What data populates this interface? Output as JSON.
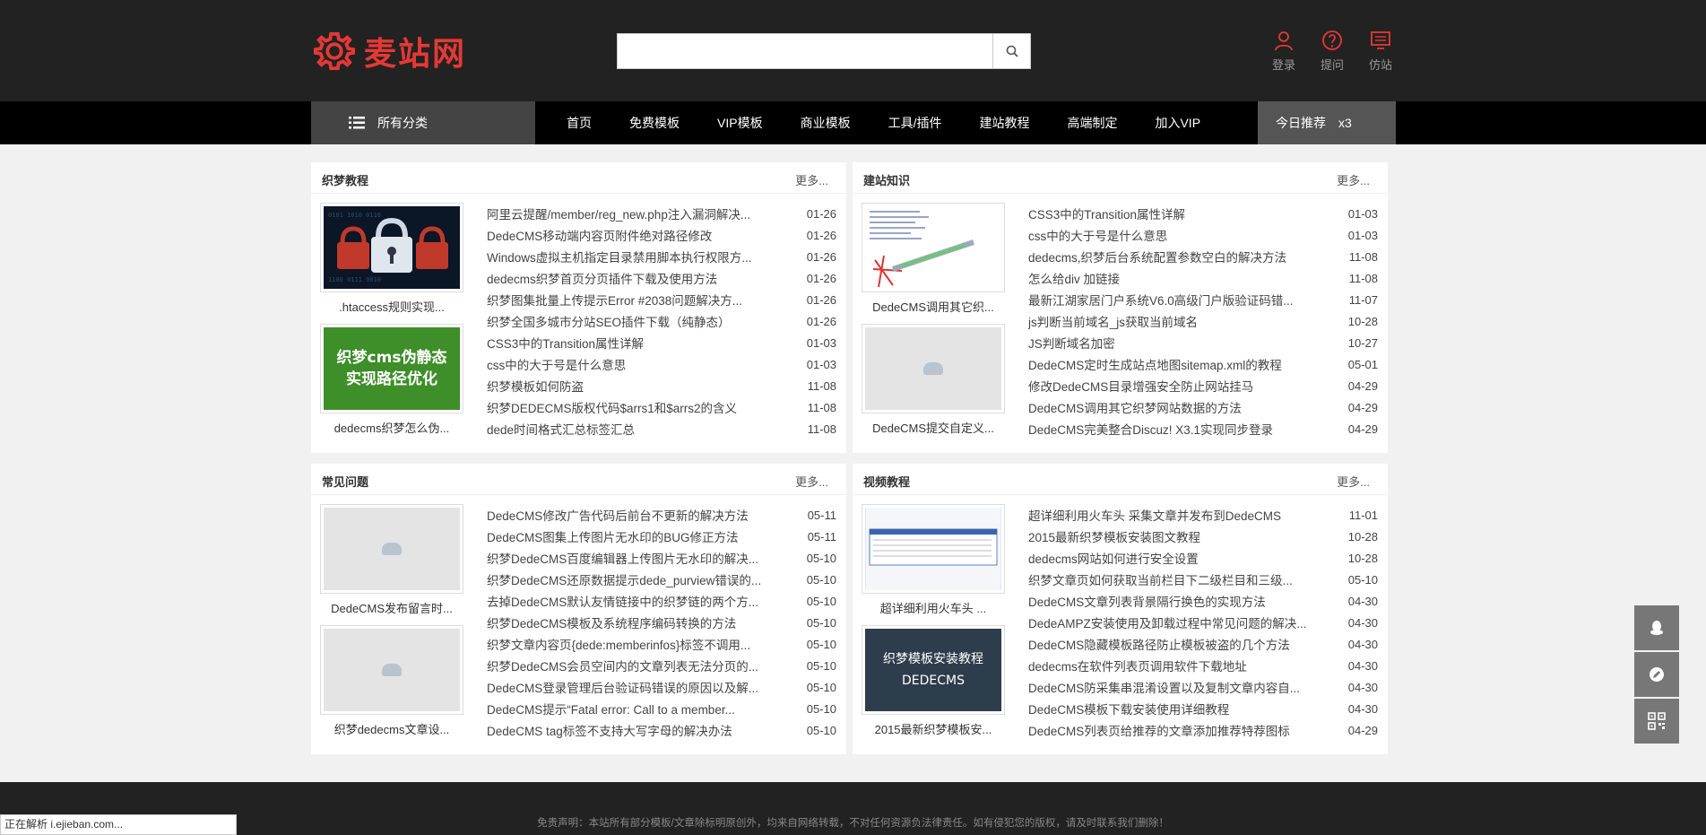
{
  "logo": {
    "text": "麦站网"
  },
  "search": {
    "placeholder": ""
  },
  "user_links": [
    {
      "label": "登录",
      "icon": "user-icon"
    },
    {
      "label": "提问",
      "icon": "question-icon"
    },
    {
      "label": "仿站",
      "icon": "monitor-icon"
    }
  ],
  "nav": {
    "category_label": "所有分类",
    "items": [
      "首页",
      "免费模板",
      "VIP模板",
      "商业模板",
      "工具/插件",
      "建站教程",
      "高端制定",
      "加入VIP"
    ],
    "recommend_label": "今日推荐",
    "recommend_count": "x3"
  },
  "panels": [
    {
      "title": "织梦教程",
      "more": "更多...",
      "thumbs": [
        {
          "caption": ".htaccess规则实现...",
          "kind": "lock-image"
        },
        {
          "caption": "dedecms织梦怎么伪...",
          "kind": "green-banner",
          "banner_line1": "织梦cms伪静态",
          "banner_line2": "实现路径优化"
        }
      ],
      "rows": [
        {
          "title": "阿里云提醒/member/reg_new.php注入漏洞解决...",
          "date": "01-26"
        },
        {
          "title": "DedeCMS移动端内容页附件绝对路径修改",
          "date": "01-26"
        },
        {
          "title": "Windows虚拟主机指定目录禁用脚本执行权限方...",
          "date": "01-26"
        },
        {
          "title": "dedecms织梦首页分页插件下载及使用方法",
          "date": "01-26"
        },
        {
          "title": "织梦图集批量上传提示Error #2038问题解决方...",
          "date": "01-26"
        },
        {
          "title": "织梦全国多城市分站SEO插件下载（纯静态）",
          "date": "01-26"
        },
        {
          "title": "CSS3中的Transition属性详解",
          "date": "01-03"
        },
        {
          "title": "css中的大于号是什么意思",
          "date": "01-03"
        },
        {
          "title": "织梦模板如何防盗",
          "date": "11-08"
        },
        {
          "title": "织梦DEDECMS版权代码$arrs1和$arrs2的含义",
          "date": "11-08"
        },
        {
          "title": "dede时间格式汇总标签汇总",
          "date": "11-08"
        }
      ]
    },
    {
      "title": "建站知识",
      "more": "更多...",
      "thumbs": [
        {
          "caption": "DedeCMS调用其它织...",
          "kind": "code-image"
        },
        {
          "caption": "DedeCMS提交自定义...",
          "kind": "placeholder"
        }
      ],
      "rows": [
        {
          "title": "CSS3中的Transition属性详解",
          "date": "01-03"
        },
        {
          "title": "css中的大于号是什么意思",
          "date": "01-03"
        },
        {
          "title": "dedecms,织梦后台系统配置参数空白的解决方法",
          "date": "11-08"
        },
        {
          "title": "怎么给div 加链接",
          "date": "11-08"
        },
        {
          "title": "最新江湖家居门户系统V6.0高级门户版验证码错...",
          "date": "11-07"
        },
        {
          "title": "js判断当前域名_js获取当前域名",
          "date": "10-28"
        },
        {
          "title": "JS判断域名加密",
          "date": "10-27"
        },
        {
          "title": "DedeCMS定时生成站点地图sitemap.xml的教程",
          "date": "05-01"
        },
        {
          "title": "修改DedeCMS目录增强安全防止网站挂马",
          "date": "04-29"
        },
        {
          "title": "DedeCMS调用其它织梦网站数据的方法",
          "date": "04-29"
        },
        {
          "title": "DedeCMS完美整合Discuz! X3.1实现同步登录",
          "date": "04-29"
        }
      ]
    },
    {
      "title": "常见问题",
      "more": "更多...",
      "thumbs": [
        {
          "caption": "DedeCMS发布留言时...",
          "kind": "placeholder"
        },
        {
          "caption": "织梦dedecms文章设...",
          "kind": "placeholder"
        }
      ],
      "rows": [
        {
          "title": "DedeCMS修改广告代码后前台不更新的解决方法",
          "date": "05-11"
        },
        {
          "title": "DedeCMS图集上传图片无水印的BUG修正方法",
          "date": "05-11"
        },
        {
          "title": "织梦DedeCMS百度编辑器上传图片无水印的解决...",
          "date": "05-10"
        },
        {
          "title": "织梦DedeCMS还原数据提示dede_purview错误的...",
          "date": "05-10"
        },
        {
          "title": "去掉DedeCMS默认友情链接中的织梦链的两个方...",
          "date": "05-10"
        },
        {
          "title": "织梦DedeCMS模板及系统程序编码转换的方法",
          "date": "05-10"
        },
        {
          "title": "织梦文章内容页{dede:memberinfos}标签不调用...",
          "date": "05-10"
        },
        {
          "title": "织梦DedeCMS会员空间内的文章列表无法分页的...",
          "date": "05-10"
        },
        {
          "title": "DedeCMS登录管理后台验证码错误的原因以及解...",
          "date": "05-10"
        },
        {
          "title": "DedeCMS提示“Fatal error: Call to a member...",
          "date": "05-10"
        },
        {
          "title": "DedeCMS tag标签不支持大写字母的解决办法",
          "date": "05-10"
        }
      ]
    },
    {
      "title": "视频教程",
      "more": "更多...",
      "thumbs": [
        {
          "caption": "超详细利用火车头 ...",
          "kind": "window-image"
        },
        {
          "caption": "2015最新织梦模板安...",
          "kind": "dark-banner",
          "banner_line1": "织梦模板安装教程",
          "banner_line2": "DEDECMS"
        }
      ],
      "rows": [
        {
          "title": "超详细利用火车头 采集文章并发布到DedeCMS",
          "date": "11-01"
        },
        {
          "title": "2015最新织梦模板安装图文教程",
          "date": "10-28"
        },
        {
          "title": "dedecms网站如何进行安全设置",
          "date": "10-28"
        },
        {
          "title": "织梦文章页如何获取当前栏目下二级栏目和三级...",
          "date": "05-10"
        },
        {
          "title": "DedeCMS文章列表背景隔行换色的实现方法",
          "date": "04-30"
        },
        {
          "title": "DedeAMPZ安装使用及卸载过程中常见问题的解决...",
          "date": "04-30"
        },
        {
          "title": "DedeCMS隐藏模板路径防止模板被盗的几个方法",
          "date": "04-30"
        },
        {
          "title": "dedecms在软件列表页调用软件下载地址",
          "date": "04-30"
        },
        {
          "title": "DedeCMS防采集串混淆设置以及复制文章内容自...",
          "date": "04-30"
        },
        {
          "title": "DedeCMS模板下载安装使用详细教程",
          "date": "04-30"
        },
        {
          "title": "DedeCMS列表页给推荐的文章添加推荐特荐图标",
          "date": "04-29"
        }
      ]
    }
  ],
  "side_tools": [
    {
      "icon": "qq-icon"
    },
    {
      "icon": "edit-icon"
    },
    {
      "icon": "qrcode-icon"
    }
  ],
  "footer": {
    "text": "免责声明：本站所有部分模板/文章除标明原创外，均来自网络转载，不对任何资源负法律责任。如有侵犯您的版权，请及时联系我们删除！"
  },
  "status_bar": {
    "text": "正在解析 i.ejieban.com..."
  },
  "colors": {
    "brand": "#e53935",
    "header_bg": "#222222",
    "nav_bg": "#000000"
  }
}
